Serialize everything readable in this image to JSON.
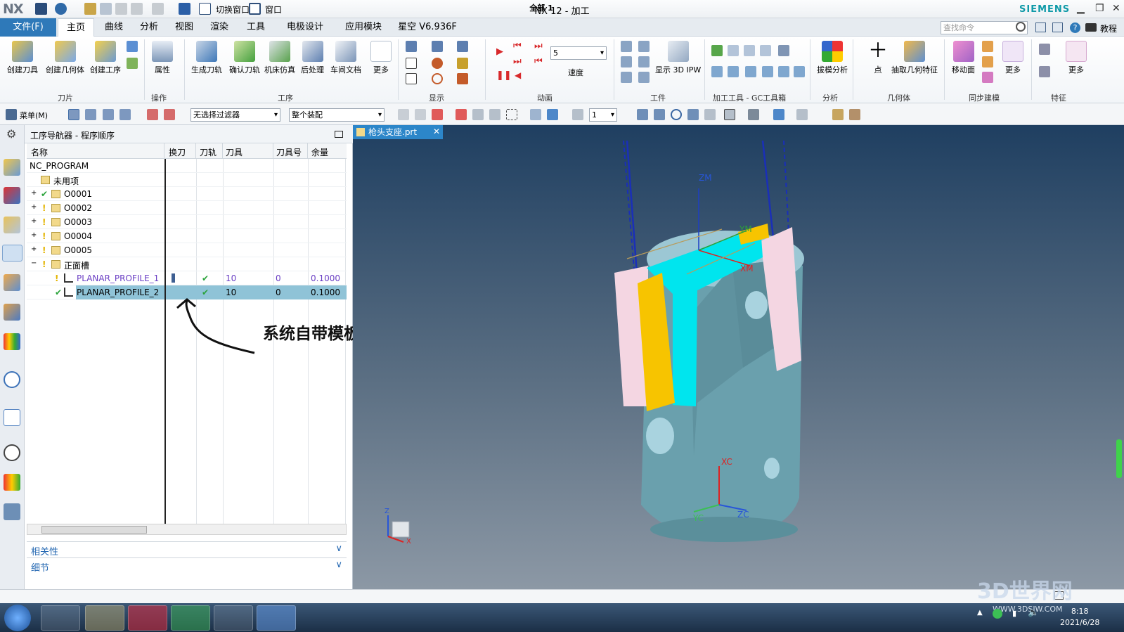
{
  "titlebar": {
    "logo": "NX",
    "title": "NX 12 - 加工",
    "brand": "SIEMENS",
    "switch_window": "切换窗口",
    "window": "窗口"
  },
  "menu": {
    "file": "文件(F)",
    "tabs": [
      "主页",
      "曲线",
      "分析",
      "视图",
      "渲染",
      "工具",
      "电极设计",
      "应用模块",
      "星空 V6.936F"
    ],
    "search_placeholder": "查找命令",
    "help": "教程"
  },
  "ribbon": {
    "buttons": [
      "创建刀具",
      "创建几何体",
      "创建工序",
      "属性",
      "生成刀轨",
      "确认刀轨",
      "机床仿真",
      "后处理",
      "车间文档",
      "更多",
      "速度",
      "显示 3D IPW",
      "拔模分析",
      "点",
      "抽取几何特征",
      "移动面",
      "更多",
      "更多"
    ],
    "groups": [
      "刀片",
      "操作",
      "工序",
      "显示",
      "动画",
      "工件",
      "加工工具 - GC工具箱",
      "分析",
      "几何体",
      "同步建模",
      "特征"
    ],
    "speed_value": "5"
  },
  "toolbar2": {
    "menu": "菜单(M)",
    "filter": "无选择过滤器",
    "assembly": "整个装配",
    "layer": "1"
  },
  "navigator": {
    "title": "工序导航器 - 程序顺序",
    "columns": [
      "名称",
      "换刀",
      "刀轨",
      "刀具",
      "刀具号",
      "余量"
    ],
    "rows": [
      {
        "name": "NC_PROGRAM"
      },
      {
        "name": "未用项"
      },
      {
        "name": "O0001"
      },
      {
        "name": "O0002"
      },
      {
        "name": "O0003"
      },
      {
        "name": "O0004"
      },
      {
        "name": "O0005"
      },
      {
        "name": "正面槽"
      },
      {
        "name": "PLANAR_PROFILE_1",
        "tool": "10",
        "toolno": "0",
        "stock": "0.1000"
      },
      {
        "name": "PLANAR_PROFILE_2",
        "tool": "10",
        "toolno": "0",
        "stock": "0.1000"
      }
    ],
    "panels": [
      "相关性",
      "细节"
    ]
  },
  "annotation": "系统自带模板",
  "viewport": {
    "tab": "枪头支座.prt",
    "axes": {
      "zm": "ZM",
      "ym": "YM",
      "xm": "XM",
      "xc": "XC",
      "yc": "YC",
      "zc": "ZC",
      "z": "Z",
      "x": "X"
    }
  },
  "status": "全部 1",
  "taskbar": {
    "time": "8:18",
    "date": "2021/6/28"
  },
  "watermark": {
    "brand": "3D世界网",
    "url": "WWW.3DSJW.COM"
  },
  "colors": {
    "accent": "#2e79b9",
    "selection": "#8fc3d7",
    "part": "#6aa0ad",
    "cyan": "#00e5ee",
    "yellow": "#f7c400",
    "pink": "#f4d6e2"
  }
}
